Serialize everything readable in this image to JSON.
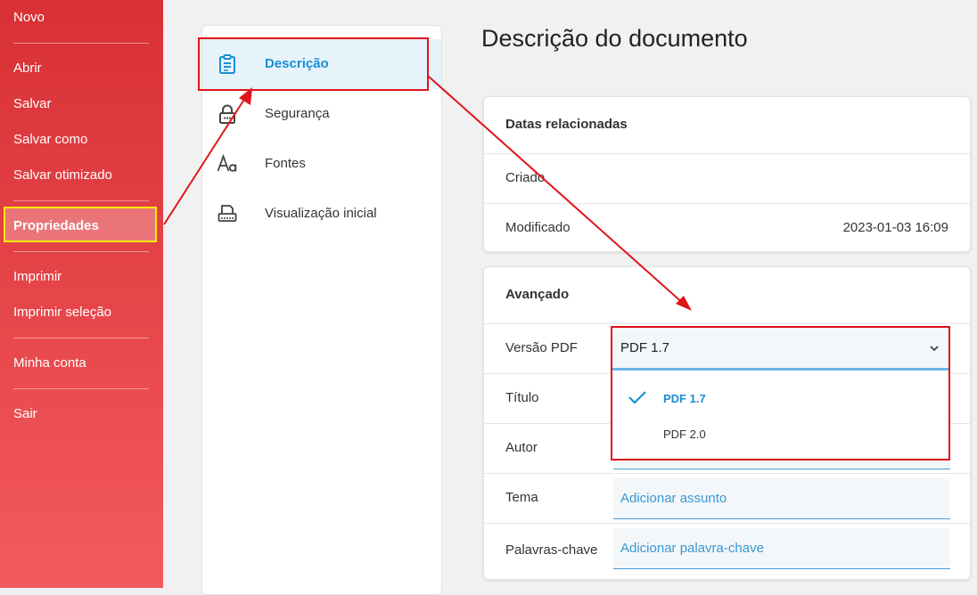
{
  "menu": {
    "items": [
      "Novo",
      "Abrir",
      "Salvar",
      "Salvar como",
      "Salvar otimizado",
      "Propriedades",
      "Imprimir",
      "Imprimir seleção",
      "Minha conta",
      "Sair"
    ]
  },
  "nav": {
    "items": [
      "Descrição",
      "Segurança",
      "Fontes",
      "Visualização inicial"
    ]
  },
  "page_title": "Descrição do documento",
  "dates_card": {
    "header": "Datas relacionadas",
    "created_label": "Criado",
    "created_value": "",
    "modified_label": "Modificado",
    "modified_value": "2023-01-03 16:09"
  },
  "advanced_card": {
    "header": "Avançado",
    "version_label": "Versão PDF",
    "version_value": "PDF 1.7",
    "version_options": [
      "PDF 1.7",
      "PDF 2.0"
    ],
    "title_label": "Título",
    "author_label": "Autor",
    "subject_label": "Tema",
    "subject_placeholder": "Adicionar assunto",
    "keywords_label": "Palavras-chave",
    "keywords_placeholder": "Adicionar palavra-chave"
  },
  "colors": {
    "menu_red": "#d83035",
    "accent_blue": "#1a8fd1",
    "annotation_red": "#e0141a",
    "annotation_yellow": "#ffee00"
  }
}
